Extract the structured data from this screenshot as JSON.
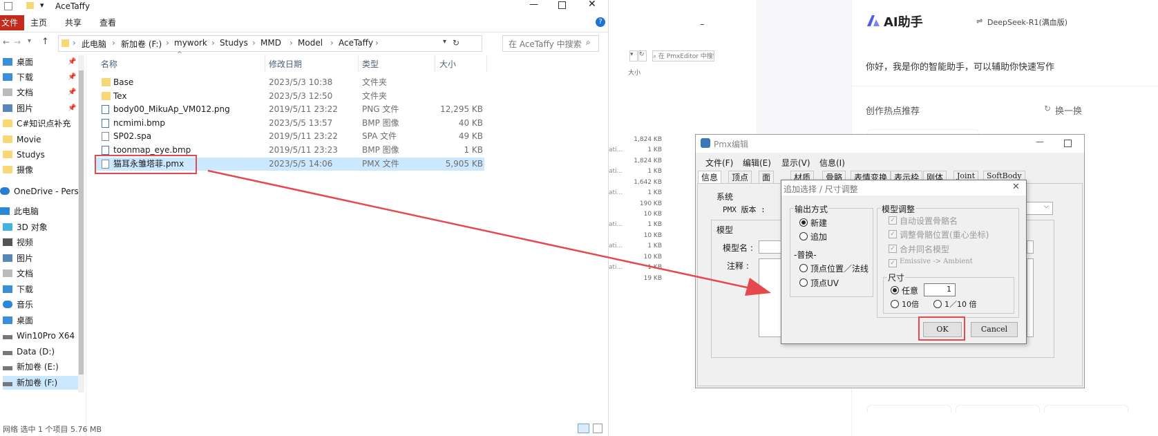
{
  "explorer": {
    "title": "AceTaffy",
    "ribbon_tabs": [
      "文件",
      "主页",
      "共享",
      "查看"
    ],
    "breadcrumb": [
      "此电脑",
      "新加卷 (F:)",
      "mywork",
      "Studys",
      "MMD",
      "Model",
      "AceTaffy"
    ],
    "search_placeholder": "在 AceTaffy 中搜索",
    "columns": {
      "name": "名称",
      "date": "修改日期",
      "type": "类型",
      "size": "大小"
    },
    "files": [
      {
        "name": "Base",
        "date": "2023/5/3 10:38",
        "type": "文件夹",
        "size": "",
        "icon": "folder-icon"
      },
      {
        "name": "Tex",
        "date": "2023/5/3 12:50",
        "type": "文件夹",
        "size": "",
        "icon": "folder-icon"
      },
      {
        "name": "body00_MikuAp_VM012.png",
        "date": "2019/5/11 23:22",
        "type": "PNG 文件",
        "size": "12,295 KB",
        "icon": "image-file-icon"
      },
      {
        "name": "ncmimi.bmp",
        "date": "2023/5/5 13:57",
        "type": "BMP 图像",
        "size": "40 KB",
        "icon": "image-file-icon"
      },
      {
        "name": "SP02.spa",
        "date": "2019/5/11 23:22",
        "type": "SPA 文件",
        "size": "49 KB",
        "icon": "file-icon"
      },
      {
        "name": "toonmap_eye.bmp",
        "date": "2019/5/11 23:23",
        "type": "BMP 图像",
        "size": "1 KB",
        "icon": "image-file-icon"
      },
      {
        "name": "猫耳永雏塔菲.pmx",
        "date": "2023/5/5 14:06",
        "type": "PMX 文件",
        "size": "5,905 KB",
        "icon": "file-icon"
      }
    ],
    "nav": [
      {
        "label": "桌面",
        "icon": "desktop-icon"
      },
      {
        "label": "下载",
        "icon": "download-icon"
      },
      {
        "label": "文档",
        "icon": "document-icon"
      },
      {
        "label": "图片",
        "icon": "picture-icon"
      },
      {
        "label": "C#知识点补充",
        "icon": "folder-icon"
      },
      {
        "label": "Movie",
        "icon": "folder-icon"
      },
      {
        "label": "Studys",
        "icon": "folder-icon"
      },
      {
        "label": "摄像",
        "icon": "folder-icon"
      },
      {
        "label": "OneDrive - Perso",
        "icon": "cloud-icon"
      },
      {
        "label": "此电脑",
        "icon": "computer-icon"
      },
      {
        "label": "3D 对象",
        "icon": "cube-icon"
      },
      {
        "label": "视频",
        "icon": "video-icon"
      },
      {
        "label": "图片",
        "icon": "picture-icon"
      },
      {
        "label": "文档",
        "icon": "document-icon"
      },
      {
        "label": "下载",
        "icon": "download-icon"
      },
      {
        "label": "音乐",
        "icon": "music-icon"
      },
      {
        "label": "桌面",
        "icon": "desktop-icon"
      },
      {
        "label": "Win10Pro X64",
        "icon": "drive-icon"
      },
      {
        "label": "Data (D:)",
        "icon": "drive-icon"
      },
      {
        "label": "新加卷 (E:)",
        "icon": "drive-icon"
      },
      {
        "label": "新加卷 (F:)",
        "icon": "drive-icon"
      }
    ],
    "status": "网络    选中 1 个项目 5.76 MB"
  },
  "bg_editor": {
    "search_placeholder": "在 PmxEditor 中搜索",
    "size_header": "大小",
    "sizes": [
      "1,824 KB",
      "1 KB",
      "1,824 KB",
      "1 KB",
      "1,642 KB",
      "1 KB",
      "190 KB",
      "10 KB",
      "1 KB",
      "10 KB",
      "1 KB",
      "10 KB",
      "1 KB",
      "19 KB"
    ],
    "snips": [
      "ati...",
      "ati...",
      "ati...",
      "ati...",
      "ati...",
      "ati..."
    ],
    "minimize": "–"
  },
  "ai": {
    "title": "AI助手",
    "model": "DeepSeek-R1(满血版)",
    "greeting": "你好，我是你的智能助手，可以辅助你快速写作",
    "hot_label": "创作热点推荐",
    "refresh_label": "换一换",
    "brand_color": "#4e5bf2"
  },
  "pmx": {
    "title": "Pmx编辑",
    "menus": [
      "文件(F)",
      "编辑(E)",
      "显示(V)",
      "信息(I)"
    ],
    "tabs": [
      "信息",
      "顶点",
      "面",
      "材质",
      "骨骼",
      "表情变换",
      "表示枠",
      "刚体",
      "Joint",
      "SoftBody"
    ],
    "system_label": "系统",
    "pmx_version_label": "PMX 版本 :",
    "model_label": "模型",
    "model_name_label": "模型名 :",
    "comment_label": "注释 :"
  },
  "modal": {
    "title": "追加选择 / 尺寸调整",
    "output_group": "输出方式",
    "opt_new": "新建",
    "opt_add": "追加",
    "replace_group": "-普换-",
    "opt_vertex_pos": "顶点位置／法线",
    "opt_vertex_uv": "顶点UV",
    "adjust_group": "模型调整",
    "chk_auto_bone": "自动设置骨骼名",
    "chk_adjust_bone": "调整骨骼位置(重心坐标)",
    "chk_merge": "合并同名模型",
    "chk_emissive": "Emissive -> Ambient",
    "size_group": "尺寸",
    "opt_any": "任意",
    "size_value": "1",
    "opt_10x": "10倍",
    "opt_tenth": "1／10 倍",
    "ok": "OK",
    "cancel": "Cancel"
  },
  "annotation_color": "#e5484d"
}
